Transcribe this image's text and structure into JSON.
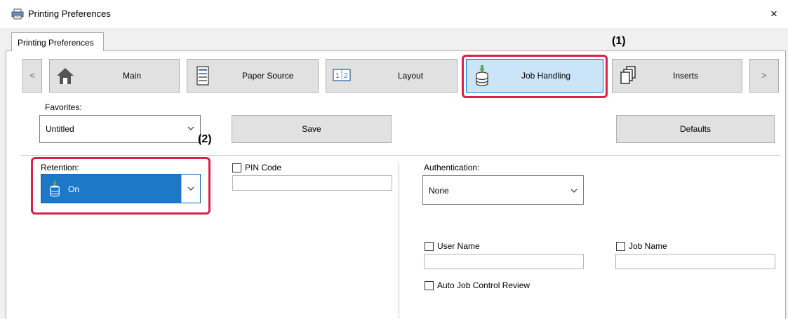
{
  "window": {
    "title": "Printing Preferences",
    "close_glyph": "×",
    "icon": "printer-icon"
  },
  "outer_tab": {
    "label": "Printing Preferences"
  },
  "tabs": {
    "scroll_left": "<",
    "scroll_right": ">",
    "items": [
      {
        "label": "Main",
        "icon": "home-icon"
      },
      {
        "label": "Paper Source",
        "icon": "paper-tray-icon"
      },
      {
        "label": "Layout",
        "icon": "layout-icon"
      },
      {
        "label": "Job Handling",
        "icon": "job-storage-icon",
        "active": true
      },
      {
        "label": "Inserts",
        "icon": "inserts-icon"
      }
    ]
  },
  "callouts": {
    "one": "(1)",
    "two": "(2)"
  },
  "favorites": {
    "label": "Favorites:",
    "value": "Untitled",
    "save_label": "Save",
    "defaults_label": "Defaults"
  },
  "retention": {
    "label": "Retention:",
    "value": "On"
  },
  "pin": {
    "label": "PIN Code",
    "checked": false,
    "value": ""
  },
  "authentication": {
    "label": "Authentication:",
    "value": "None"
  },
  "user_name": {
    "label": "User Name",
    "checked": false,
    "value": ""
  },
  "job_name": {
    "label": "Job Name",
    "checked": false,
    "value": ""
  },
  "auto_review": {
    "label": "Auto Job Control Review",
    "checked": false
  },
  "colors": {
    "highlight": "#d9214a",
    "active_tab": "#cce4f7",
    "selected_combo": "#1e78c8",
    "storage_arrow": "#4caf50"
  }
}
